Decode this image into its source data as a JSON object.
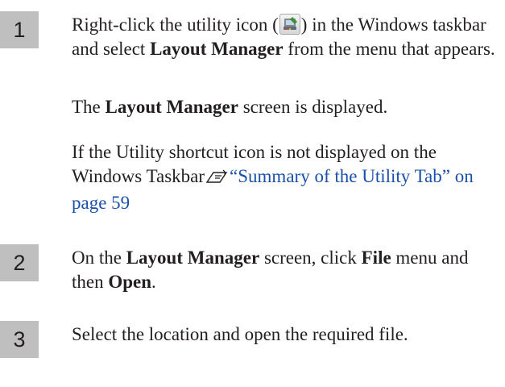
{
  "steps": [
    {
      "number": "1",
      "paragraphs": [
        {
          "before_icon": "Right-click the utility icon (",
          "icon": "utility-tray-icon",
          "after_icon": ") in the Windows taskbar and select ",
          "bold": "Layout Manager",
          "after_bold": " from the menu that appears."
        }
      ],
      "result": {
        "before": "The ",
        "bold": "Layout Manager",
        "after": " screen is displayed."
      },
      "note": {
        "text": "If the Utility shortcut icon is not displayed on the Windows Taskbar",
        "ref_icon": "reference-pointer-icon",
        "link": "“Summary of the Utility Tab” on page 59"
      }
    },
    {
      "number": "2",
      "text_1": "On the ",
      "bold_1": "Layout Manager",
      "text_2": " screen, click ",
      "bold_2": "File",
      "text_3": " menu and then ",
      "bold_3": "Open",
      "text_4": "."
    },
    {
      "number": "3",
      "text": "Select the location and open the required file."
    }
  ]
}
